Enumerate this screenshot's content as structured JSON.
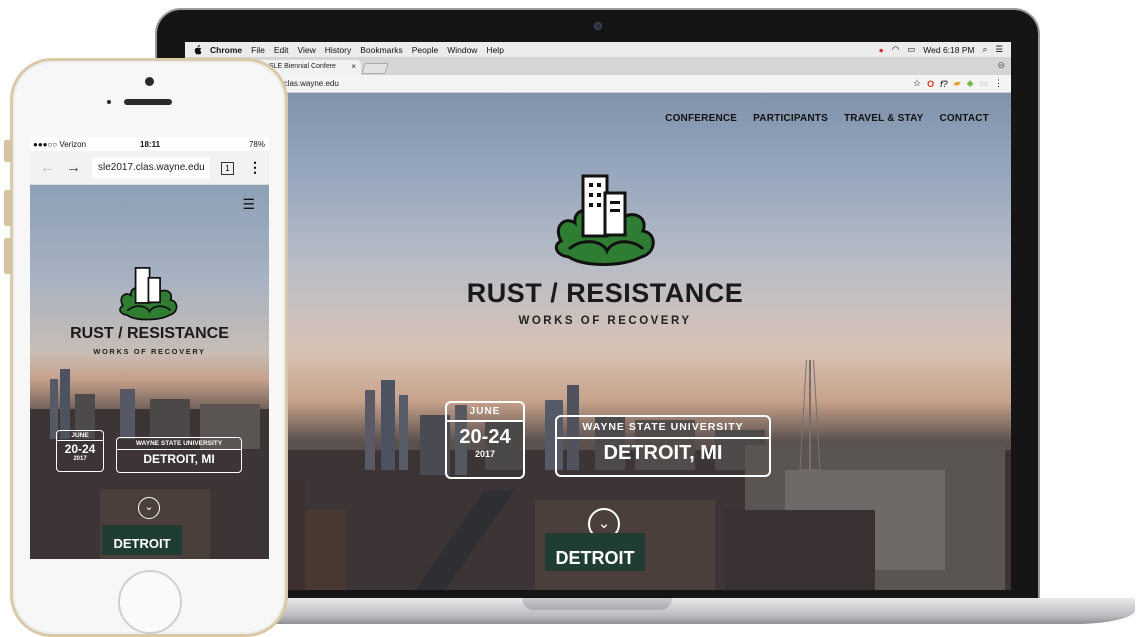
{
  "laptop": {
    "menubar": {
      "app": "Chrome",
      "items": [
        "File",
        "Edit",
        "View",
        "History",
        "Bookmarks",
        "People",
        "Window",
        "Help"
      ],
      "clock": "Wed 6:18 PM"
    },
    "tab": {
      "title": "SLE Biennial Confere",
      "close": "×"
    },
    "address": "7.clas.wayne.edu",
    "site": {
      "nav": [
        "CONFERENCE",
        "PARTICIPANTS",
        "TRAVEL & STAY",
        "CONTACT"
      ],
      "title": "RUST / RESISTANCE",
      "subtitle": "WORKS OF RECOVERY",
      "date": {
        "month": "JUNE",
        "days": "20-24",
        "year": "2017"
      },
      "venue": {
        "university": "WAYNE STATE UNIVERSITY",
        "city": "DETROIT, MI"
      },
      "sign": "DETROIT"
    }
  },
  "phone": {
    "status": {
      "carrier": "●●●○○ Verizon",
      "time": "18:11",
      "battery": "78%"
    },
    "url": "sle2017.clas.wayne.edu",
    "tabs_count": "1",
    "site": {
      "title": "RUST / RESISTANCE",
      "subtitle": "WORKS OF RECOVERY",
      "date": {
        "month": "JUNE",
        "days": "20-24",
        "year": "2017"
      },
      "venue": {
        "university": "WAYNE STATE UNIVERSITY",
        "city": "DETROIT, MI"
      },
      "sign": "DETROIT"
    }
  },
  "colors": {
    "accent_green": "#2e7d32",
    "sign_green": "#1f3d33"
  }
}
